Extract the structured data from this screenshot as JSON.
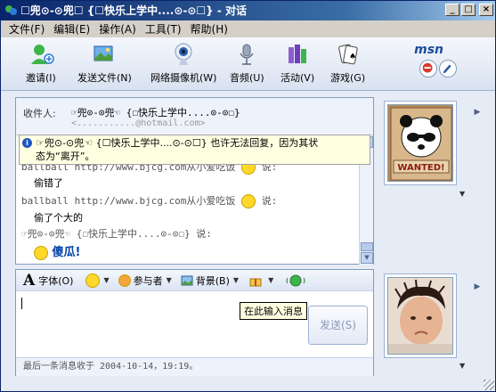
{
  "window": {
    "title": "☐兜⊙-⊙兜☐ {☐快乐上学中....⊙-⊙☐} - 对话",
    "minimize_glyph": "_",
    "maximize_glyph": "□",
    "close_glyph": "×"
  },
  "menu": [
    "文件(F)",
    "编辑(E)",
    "操作(A)",
    "工具(T)",
    "帮助(H)"
  ],
  "toolbar": {
    "items": [
      {
        "label": "邀请(I)",
        "icon": "invite-icon"
      },
      {
        "label": "发送文件(N)",
        "icon": "send-file-icon"
      },
      {
        "label": "网络摄像机(W)",
        "icon": "webcam-icon"
      },
      {
        "label": "音频(U)",
        "icon": "audio-icon"
      },
      {
        "label": "活动(V)",
        "icon": "activities-icon"
      },
      {
        "label": "游戏(G)",
        "icon": "games-icon"
      }
    ],
    "logo": "msn"
  },
  "recipient": {
    "label": "收件人:",
    "name": "☞兜⊙-⊙兜☜ {☐快乐上学中....⊙-⊙☐}",
    "email": "<...........@hotmail.com>"
  },
  "info_bar": {
    "line1": "☞兜⊙-⊙兜☜ {☐快乐上学中....⊙-⊙☐} 也许无法回复，因为其状",
    "line2": "态为“离开”。"
  },
  "messages": [
    {
      "header": "ballball http://www.bjcg.com从小爱吃饭",
      "header_suffix": "说:",
      "body": "偷错了"
    },
    {
      "header": "ballball http://www.bjcg.com从小爱吃饭",
      "header_suffix": "说:",
      "body": "偷了个大的"
    },
    {
      "header": "☞兜⊙-⊙兜☜ {☐快乐上学中....⊙-⊙☐} 说:",
      "header_suffix": "",
      "body": "傻瓜!"
    }
  ],
  "format_bar": {
    "font_label": "字体(O)",
    "participants_label": "参与者",
    "background_label": "背景(B)"
  },
  "send_button": "发送(S)",
  "tooltip": "在此输入消息",
  "status": "最后一条消息收于 2004-10-14，19:19。",
  "avatars": {
    "remote_caption": "WANTED!"
  },
  "colors": {
    "title_start": "#0a246a",
    "title_end": "#a6caf0",
    "panel_border": "#7f9db9",
    "info_bg": "#ffffe1",
    "emphasis_blue": "#0044aa"
  }
}
